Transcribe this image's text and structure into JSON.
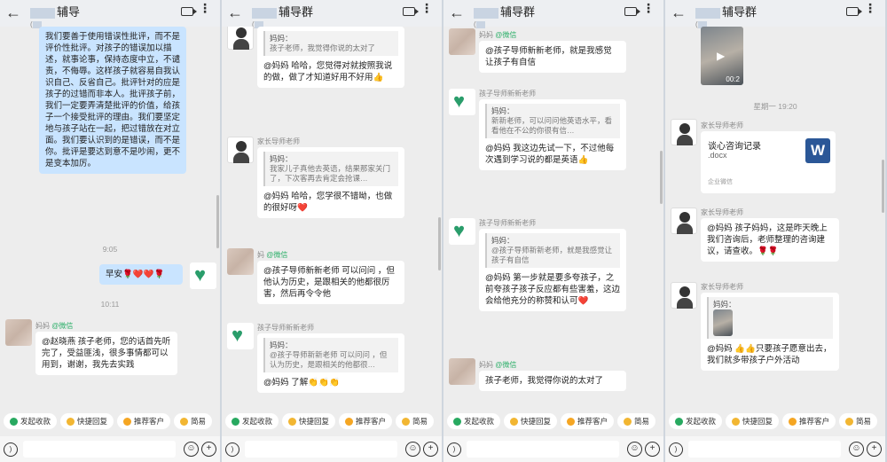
{
  "panels": [
    {
      "title": "辅导",
      "subtitle": "(",
      "messages": {
        "m1": "我们要善于使用错误性批评，而不是评价性批评。对孩子的错误加以描述，就事论事，保持态度中立，不谴责，不侮辱。这样孩子就容易自我认识自己、反省自己。批评针对的应是孩子的过错而非本人。批评孩子前，我们一定要弄清楚批评的价值，给孩子一个接受批评的理由。我们要坚定地与孩子站在一起，把过错放在对立面。我们要认识到的是错误，而不是你。批评是要达到意不是吵闹，更不是变本加厉。",
        "time1": "9:05",
        "m2": "早安🌹❤️❤️🌹",
        "time2": "10:11",
        "m3_sender": "妈妈",
        "m3_wx": "@微信",
        "m3": "@赵晓燕 孩子老师，您的话首先听完了，受益匪浅，很多事情都可以用到，谢谢，我先去实践"
      }
    },
    {
      "title": "辅导群",
      "subtitle": "(",
      "messages": {
        "q1_from": "妈妈：",
        "q1_text": "孩子老师，我觉得你说的太对了",
        "m1": "@妈妈 哈哈，您觉得对就按照我说的做，做了才知道好用不好用👍",
        "m2_sender": "家长导师老师",
        "q2_from": "妈妈：",
        "q2_text": "我家儿子真他去英语，结果那家关门了，下次客再去肯定会抢课…",
        "m2": "@妈妈 哈哈，您学很不错呦，也做的很好呀❤️",
        "m3_sender": "妈",
        "m3_wx": "@微信",
        "m3": "@孩子导师新新老师 可以问问 ，但他认为历史，是跟相关的他都很厉害，然后再令令他",
        "m4_sender": "孩子导师新新老师",
        "q4_from": "妈妈：",
        "q4_text": "@孩子导师新新老师 可以问问 ，但认为历史，是跟相关的他都很…",
        "m4": "@妈妈 了解👏👏👏"
      }
    },
    {
      "title": "辅导群",
      "subtitle": "(",
      "messages": {
        "m1_sender": "妈妈",
        "m1_wx": "@微信",
        "m1": "@孩子导师新新老师，就是我感觉让孩子有自信",
        "m2_sender": "孩子导师新新老师",
        "q2_from": "妈妈：",
        "q2_text": "新新老师，可以问问他英语水平，看看他在不公的你很有信…",
        "m2": "@妈妈 我这边先试一下，不过他每次遇到学习说的都是英语👍",
        "m3_sender": "孩子导师新新老师",
        "q3_from": "妈妈：",
        "q3_text": "@孩子导师新新老师，就是我感觉让孩子有自信",
        "m3": "@妈妈 第一步就是要多夸孩子，之前夸孩子孩子反应都有些害羞，这边会给他充分的称赞和认可❤️",
        "m4_sender": "妈妈",
        "m4_wx": "@微信",
        "m4": "孩子老师，我觉得你说的太对了"
      }
    },
    {
      "title": "辅导群",
      "subtitle": "(",
      "messages": {
        "video_dur": "00:2",
        "time1": "星期一 19:20",
        "m1_sender": "家长导师老师",
        "doc_title": "谈心咨询记录",
        "doc_ext": ".docx",
        "doc_src": "企业微信",
        "m2_sender": "家长导师老师",
        "m2": "@妈妈 孩子妈妈，这是昨天晚上我们咨询后，老师整理的咨询建议，请查收。🌹🌹",
        "m3_sender": "家长导师老师",
        "q3_from": "妈妈：",
        "m3": "@妈妈 👍👍只要孩子愿意出去，我们就多带孩子户外活动"
      }
    }
  ],
  "toolbar": {
    "p1": [
      "发起收款",
      "快捷回复",
      "推荐客户",
      "简易"
    ],
    "p2": [
      "发起收款",
      "快捷回复",
      "推荐客户",
      "简易"
    ],
    "p3": [
      "发起收款",
      "快捷回复",
      "推荐客户",
      "简易"
    ],
    "p4": [
      "发起收款",
      "快捷回复",
      "推荐客户",
      "简易"
    ]
  }
}
